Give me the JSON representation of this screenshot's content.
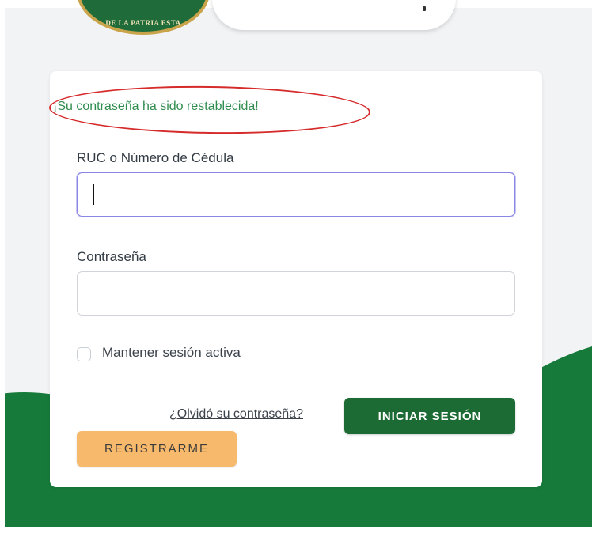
{
  "header": {
    "seal_text": "DE LA PATRIA ESTA"
  },
  "login": {
    "success_message": "¡Su contraseña ha sido restablecida!",
    "ruc_label": "RUC o Número de Cédula",
    "ruc_value": "",
    "password_label": "Contraseña",
    "password_value": "",
    "remember_label": "Mantener sesión activa",
    "remember_checked": false,
    "forgot_link": "¿Olvidó su contraseña?",
    "login_button": "INICIAR SESIÓN",
    "register_button": "REGISTRARME"
  },
  "colors": {
    "brand_green": "#1d6b34",
    "success_green": "#2f8c4e",
    "register_orange": "#f7b96b",
    "highlight_red": "#d62b2b",
    "focus_border": "#8a86e6"
  }
}
